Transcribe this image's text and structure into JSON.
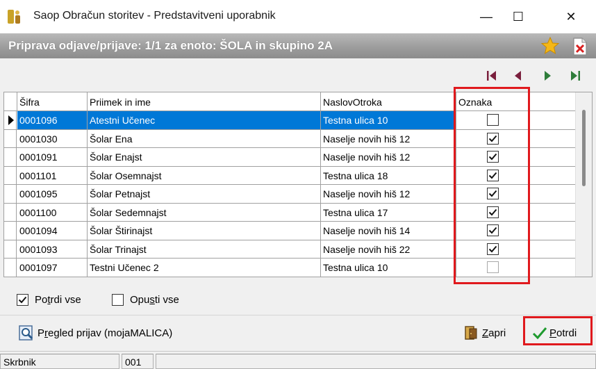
{
  "window": {
    "title": "Saop Obračun storitev - Predstavitveni uporabnik",
    "minimize_glyph": "—",
    "maximize_glyph": "☐",
    "close_glyph": "✕"
  },
  "header": {
    "title": "Priprava odjave/prijave: 1/1 za enoto: ŠOLA in skupino 2A",
    "star_icon": "star-icon",
    "close_icon": "close-document-icon"
  },
  "navigation": {
    "icons": [
      "first-record-icon",
      "previous-record-icon",
      "next-record-icon",
      "last-record-icon"
    ]
  },
  "grid": {
    "columns": [
      "Šifra",
      "Priimek in ime",
      "NaslovOtroka",
      "Oznaka"
    ],
    "rows": [
      {
        "sifra": "0001096",
        "ime": "Atestni Učenec",
        "naslov": "Testna ulica 10",
        "oznaka": false,
        "selected": true
      },
      {
        "sifra": "0001030",
        "ime": "Šolar Ena",
        "naslov": "Naselje novih hiš 12",
        "oznaka": true,
        "selected": false
      },
      {
        "sifra": "0001091",
        "ime": "Šolar Enajst",
        "naslov": "Naselje novih hiš 12",
        "oznaka": true,
        "selected": false
      },
      {
        "sifra": "0001101",
        "ime": "Šolar Osemnajst",
        "naslov": "Testna ulica 18",
        "oznaka": true,
        "selected": false
      },
      {
        "sifra": "0001095",
        "ime": "Šolar Petnajst",
        "naslov": "Naselje novih hiš 12",
        "oznaka": true,
        "selected": false
      },
      {
        "sifra": "0001100",
        "ime": "Šolar Sedemnajst",
        "naslov": "Testna ulica 17",
        "oznaka": true,
        "selected": false
      },
      {
        "sifra": "0001094",
        "ime": "Šolar Štirinajst",
        "naslov": "Naselje novih hiš 14",
        "oznaka": true,
        "selected": false
      },
      {
        "sifra": "0001093",
        "ime": "Šolar Trinajst",
        "naslov": "Naselje novih hiš 22",
        "oznaka": true,
        "selected": false
      },
      {
        "sifra": "0001097",
        "ime": "Testni Učenec 2",
        "naslov": "Testna ulica 10",
        "oznaka": false,
        "selected": false
      }
    ]
  },
  "options": {
    "confirm_all": {
      "label_pre": "Po",
      "label_acc": "t",
      "label_post": "rdi vse",
      "checked": true
    },
    "discard_all": {
      "label_pre": "Opu",
      "label_acc": "s",
      "label_post": "ti vse",
      "checked": false
    }
  },
  "buttons": {
    "preview": {
      "label_pre": "P",
      "label_acc": "r",
      "label_post": "egled prijav (mojaMALICA)"
    },
    "close": {
      "label_acc": "Z",
      "label_post": "apri"
    },
    "confirm": {
      "label_acc": "P",
      "label_post": "otrdi"
    }
  },
  "status": {
    "cell1": "Skrbnik",
    "cell2": "001",
    "cell3": ""
  },
  "colors": {
    "selection": "#0078d7",
    "highlight_border": "#e0191d",
    "header_gradient": "#9d9d9d"
  }
}
